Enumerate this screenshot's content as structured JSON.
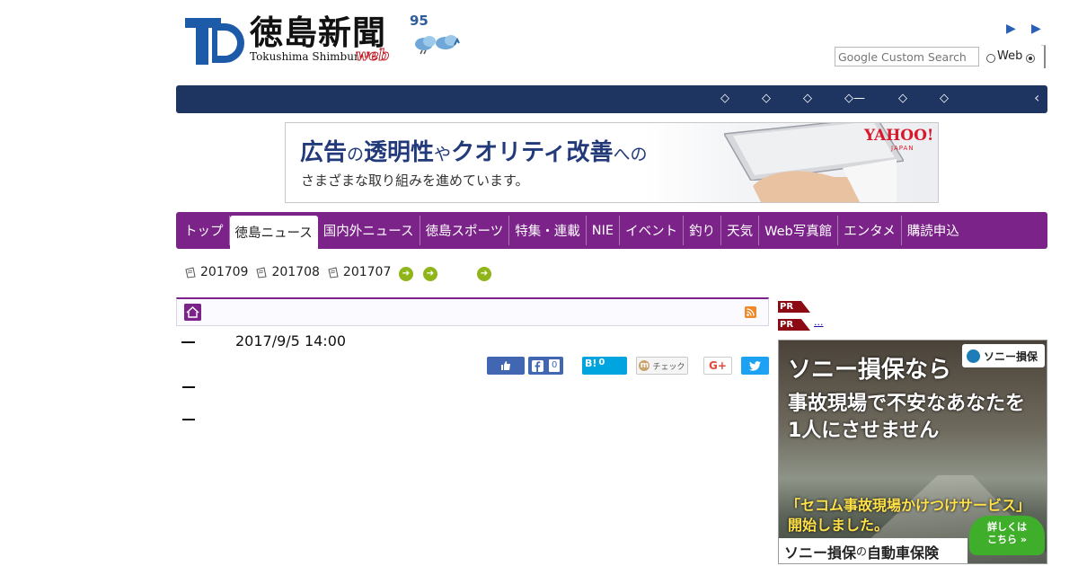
{
  "header": {
    "logo_title": "徳島新聞",
    "logo_subtitle": "Tokushima Shimbun",
    "logo_web": "web",
    "weather_number": "95",
    "top_arrows": [
      "▶",
      "▶"
    ]
  },
  "search": {
    "placeholder": "Google Custom Search",
    "radio_label": "Web"
  },
  "navbar": {
    "items": [
      "◇",
      "◇",
      "◇",
      "◇—",
      "◇",
      "◇"
    ],
    "end_caret": "‹"
  },
  "ad_banner": {
    "line1_parts": [
      "広告",
      "の",
      "透明性",
      "や",
      "クオリティ改善",
      "への"
    ],
    "line2": "さまざまな取り組みを進めています。",
    "brand": "YAHOO!",
    "brand_sub": "JAPAN"
  },
  "tabs": [
    {
      "label": "トップ",
      "active": false
    },
    {
      "label": "徳島ニュース",
      "active": true
    },
    {
      "label": "国内外ニュース",
      "active": false
    },
    {
      "label": "徳島スポーツ",
      "active": false
    },
    {
      "label": "特集・連載",
      "active": false
    },
    {
      "label": "NIE",
      "active": false
    },
    {
      "label": "イベント",
      "active": false
    },
    {
      "label": "釣り",
      "active": false
    },
    {
      "label": "天気",
      "active": false
    },
    {
      "label": "Web写真館",
      "active": false
    },
    {
      "label": "エンタメ",
      "active": false
    },
    {
      "label": "購読申込",
      "active": false
    }
  ],
  "archive": {
    "months": [
      "201709",
      "201708",
      "201707"
    ]
  },
  "article": {
    "date": "2017/9/5 14:00"
  },
  "social": {
    "facebook_share_count": "0",
    "hatena_label": "B!",
    "hatena_count": "0",
    "mixi_label": "チェック",
    "gplus_label": "G+"
  },
  "sidebar": {
    "pr_tag": "PR",
    "pr_link": "...",
    "ad": {
      "badge": "ソニー損保",
      "headline": "ソニー損保なら",
      "body_line1": "事故現場で不安なあなたを",
      "body_line2": "1人にさせません",
      "yellow_line1": "「セコム事故現場かけつけサービス」",
      "yellow_line2": "開始しました。",
      "cta_line1": "詳しくは",
      "cta_line2": "こちら »",
      "footer_main": "ソニー損保",
      "footer_small": "の",
      "footer_tail": "自動車保険"
    }
  }
}
